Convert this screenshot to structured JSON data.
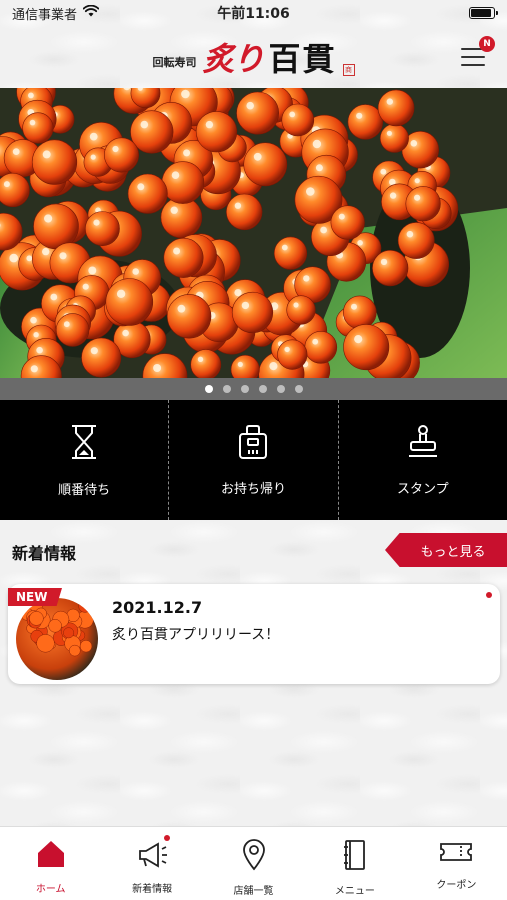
{
  "status_bar": {
    "carrier": "通信事業者",
    "time": "午前11:06",
    "battery_level": 0.9,
    "icons": [
      "wifi-icon",
      "battery-icon"
    ]
  },
  "header": {
    "logo_small": "回転寿司",
    "logo_red": "炙り",
    "logo_black": "百貫",
    "logo_stamp": "商",
    "menu_badge": "N",
    "menu_icon": "hamburger-icon"
  },
  "carousel": {
    "slide_count": 6,
    "active_index": 0,
    "image": "ikura gunkan sushi photo"
  },
  "actions": [
    {
      "label": "順番待ち",
      "icon": "hourglass-icon"
    },
    {
      "label": "お持ち帰り",
      "icon": "takeout-bag-icon"
    },
    {
      "label": "スタンプ",
      "icon": "stamp-icon"
    }
  ],
  "news": {
    "title": "新着情報",
    "more_label": "もっと見る",
    "items": [
      {
        "badge": "NEW",
        "date": "2021.12.7",
        "text": "炙り百貫アプリリリース！",
        "unread": true
      }
    ]
  },
  "tab_bar": {
    "items": [
      {
        "label": "ホーム",
        "icon": "home-icon",
        "active": true
      },
      {
        "label": "新着情報",
        "icon": "megaphone-icon",
        "active": false,
        "badge": true
      },
      {
        "label": "店舗一覧",
        "icon": "map-pin-icon",
        "active": false
      },
      {
        "label": "メニュー",
        "icon": "menu-book-icon",
        "active": false
      },
      {
        "label": "クーポン",
        "icon": "ticket-icon",
        "active": false
      }
    ]
  },
  "colors": {
    "brand_red": "#c8102e",
    "action_bar_bg": "#000000",
    "carousel_bar_bg": "#6a6a6a"
  }
}
